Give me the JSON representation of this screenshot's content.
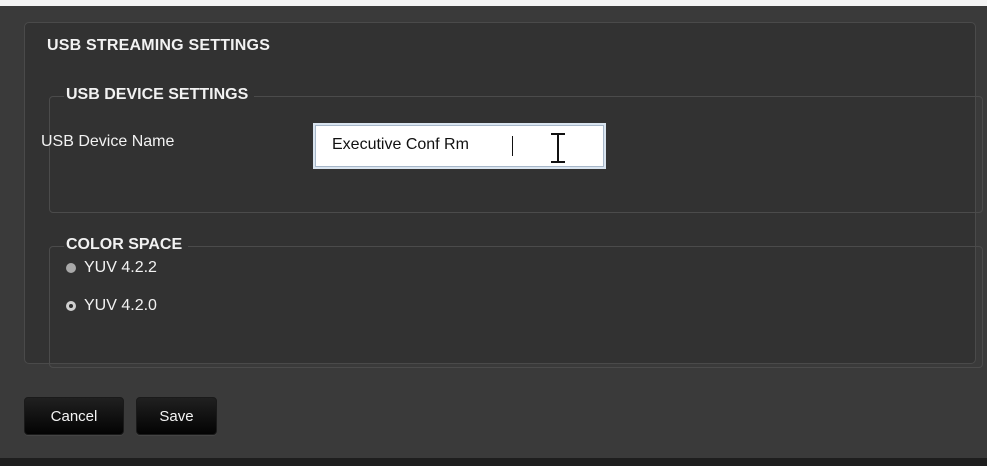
{
  "panel": {
    "title": "USB STREAMING SETTINGS"
  },
  "usb_device": {
    "legend": "USB DEVICE SETTINGS",
    "name_label": "USB Device Name",
    "name_value": "Executive Conf Rm"
  },
  "color_space": {
    "legend": "COLOR SPACE",
    "options": [
      {
        "label": "YUV 4.2.2",
        "selected": false
      },
      {
        "label": "YUV 4.2.0",
        "selected": true
      }
    ]
  },
  "actions": {
    "cancel_label": "Cancel",
    "save_label": "Save"
  },
  "theme": {
    "background": "#353535",
    "panel": "#323232",
    "text": "#f2f2f2",
    "input_border": "#a7b7c9"
  },
  "icons": {
    "cursor": "i-beam-cursor-icon",
    "radio_unchecked": "radio-unchecked-icon",
    "radio_checked": "radio-checked-icon"
  }
}
